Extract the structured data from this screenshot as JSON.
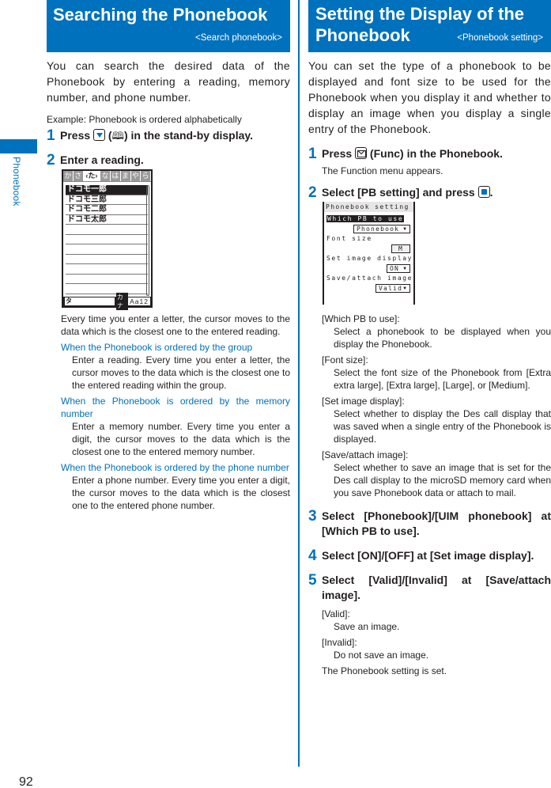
{
  "side_label": "Phonebook",
  "page_number": "92",
  "left": {
    "title": "Searching the Phonebook",
    "subtitle": "<Search phonebook>",
    "intro": "You can search the desired data of the Phonebook by entering a reading, memory number, and phone number.",
    "example": "Example: Phonebook is ordered alphabetically",
    "steps": [
      {
        "num": "1",
        "pre": "Press ",
        "key_icon": "down-key-icon",
        "mid": " (",
        "glyph_icon": "phonebook-icon",
        "glyph": "⎖",
        "post": ") in the stand-by display."
      },
      {
        "num": "2",
        "text": "Enter a reading."
      }
    ],
    "phone_screen": {
      "tabs": [
        "か",
        "さ",
        "《た》",
        "な",
        "は",
        "ま",
        "や",
        "ら"
      ],
      "active_tab": "‹た›",
      "entries": [
        "ドコモ一郎",
        "ドコモ三郎",
        "ドコモ二郎",
        "ドコモ太郎",
        "",
        "",
        "",
        "",
        "",
        "",
        ""
      ],
      "input_value": "タ",
      "mode_badge": "カナ",
      "mode_text": "Aa12"
    },
    "desc": "Every time you enter a letter, the cursor moves to the data which is the closest one to the entered reading.",
    "cases": [
      {
        "head": "When the Phonebook is ordered by the group",
        "body": "Enter a reading. Every time you enter a letter, the cursor moves to the data which is the closest one to the entered reading within the group."
      },
      {
        "head": "When the Phonebook is ordered by the memory number",
        "body": "Enter a memory number. Every time you enter a digit, the cursor moves to the data which is the closest one to the entered memory number."
      },
      {
        "head": "When the Phonebook is ordered by the phone number",
        "body": "Enter a phone number. Every time you enter a digit, the cursor moves to the data which is the closest one to the entered phone number."
      }
    ]
  },
  "right": {
    "title_line1": "Setting the Display of the",
    "title_line2": "Phonebook",
    "subtitle": "<Phonebook setting>",
    "intro": "You can set the type of a phonebook to be displayed and font size to be used for the Phonebook when you display it and whether to display an image when you display a single entry of the Phonebook.",
    "step1": {
      "num": "1",
      "pre": "Press ",
      "post": " (Func) in the Phonebook.",
      "note": "The Function menu appears."
    },
    "step2": {
      "num": "2",
      "pre": "Select [PB setting] and press ",
      "post": "."
    },
    "phone_screen": {
      "header": "Phonebook setting",
      "fields": [
        {
          "label": "Which PB to use",
          "value": "Phonebook",
          "highlighted": true
        },
        {
          "label": "Font size",
          "value": "M"
        },
        {
          "label": "Set image display",
          "value": "ON"
        },
        {
          "label": "Save/attach image",
          "value": "Valid"
        }
      ],
      "caret": "▼"
    },
    "definitions": [
      {
        "term": "[Which PB to use]:",
        "desc": "Select a phonebook to be displayed when you display the Phonebook."
      },
      {
        "term": "[Font size]:",
        "desc": "Select the font size of the Phonebook from [Extra extra large], [Extra large], [Large], or [Medium]."
      },
      {
        "term": "[Set image display]:",
        "desc": "Select whether to display the Des call display that was saved when a single entry of the Phonebook is displayed."
      },
      {
        "term": "[Save/attach image]:",
        "desc": "Select whether to save an image that is set for the Des call display to the microSD memory card when you save Phonebook data or attach to mail."
      }
    ],
    "steps": [
      {
        "num": "3",
        "text": "Select [Phonebook]/[UIM phonebook] at [Which PB to use]."
      },
      {
        "num": "4",
        "text": "Select [ON]/[OFF] at [Set image display]."
      },
      {
        "num": "5",
        "text": "Select [Valid]/[Invalid] at [Save/attach image]."
      }
    ],
    "options": [
      {
        "term": "[Valid]:",
        "desc": "Save an image."
      },
      {
        "term": "[Invalid]:",
        "desc": "Do not save an image."
      }
    ],
    "final": "The Phonebook setting is set."
  }
}
